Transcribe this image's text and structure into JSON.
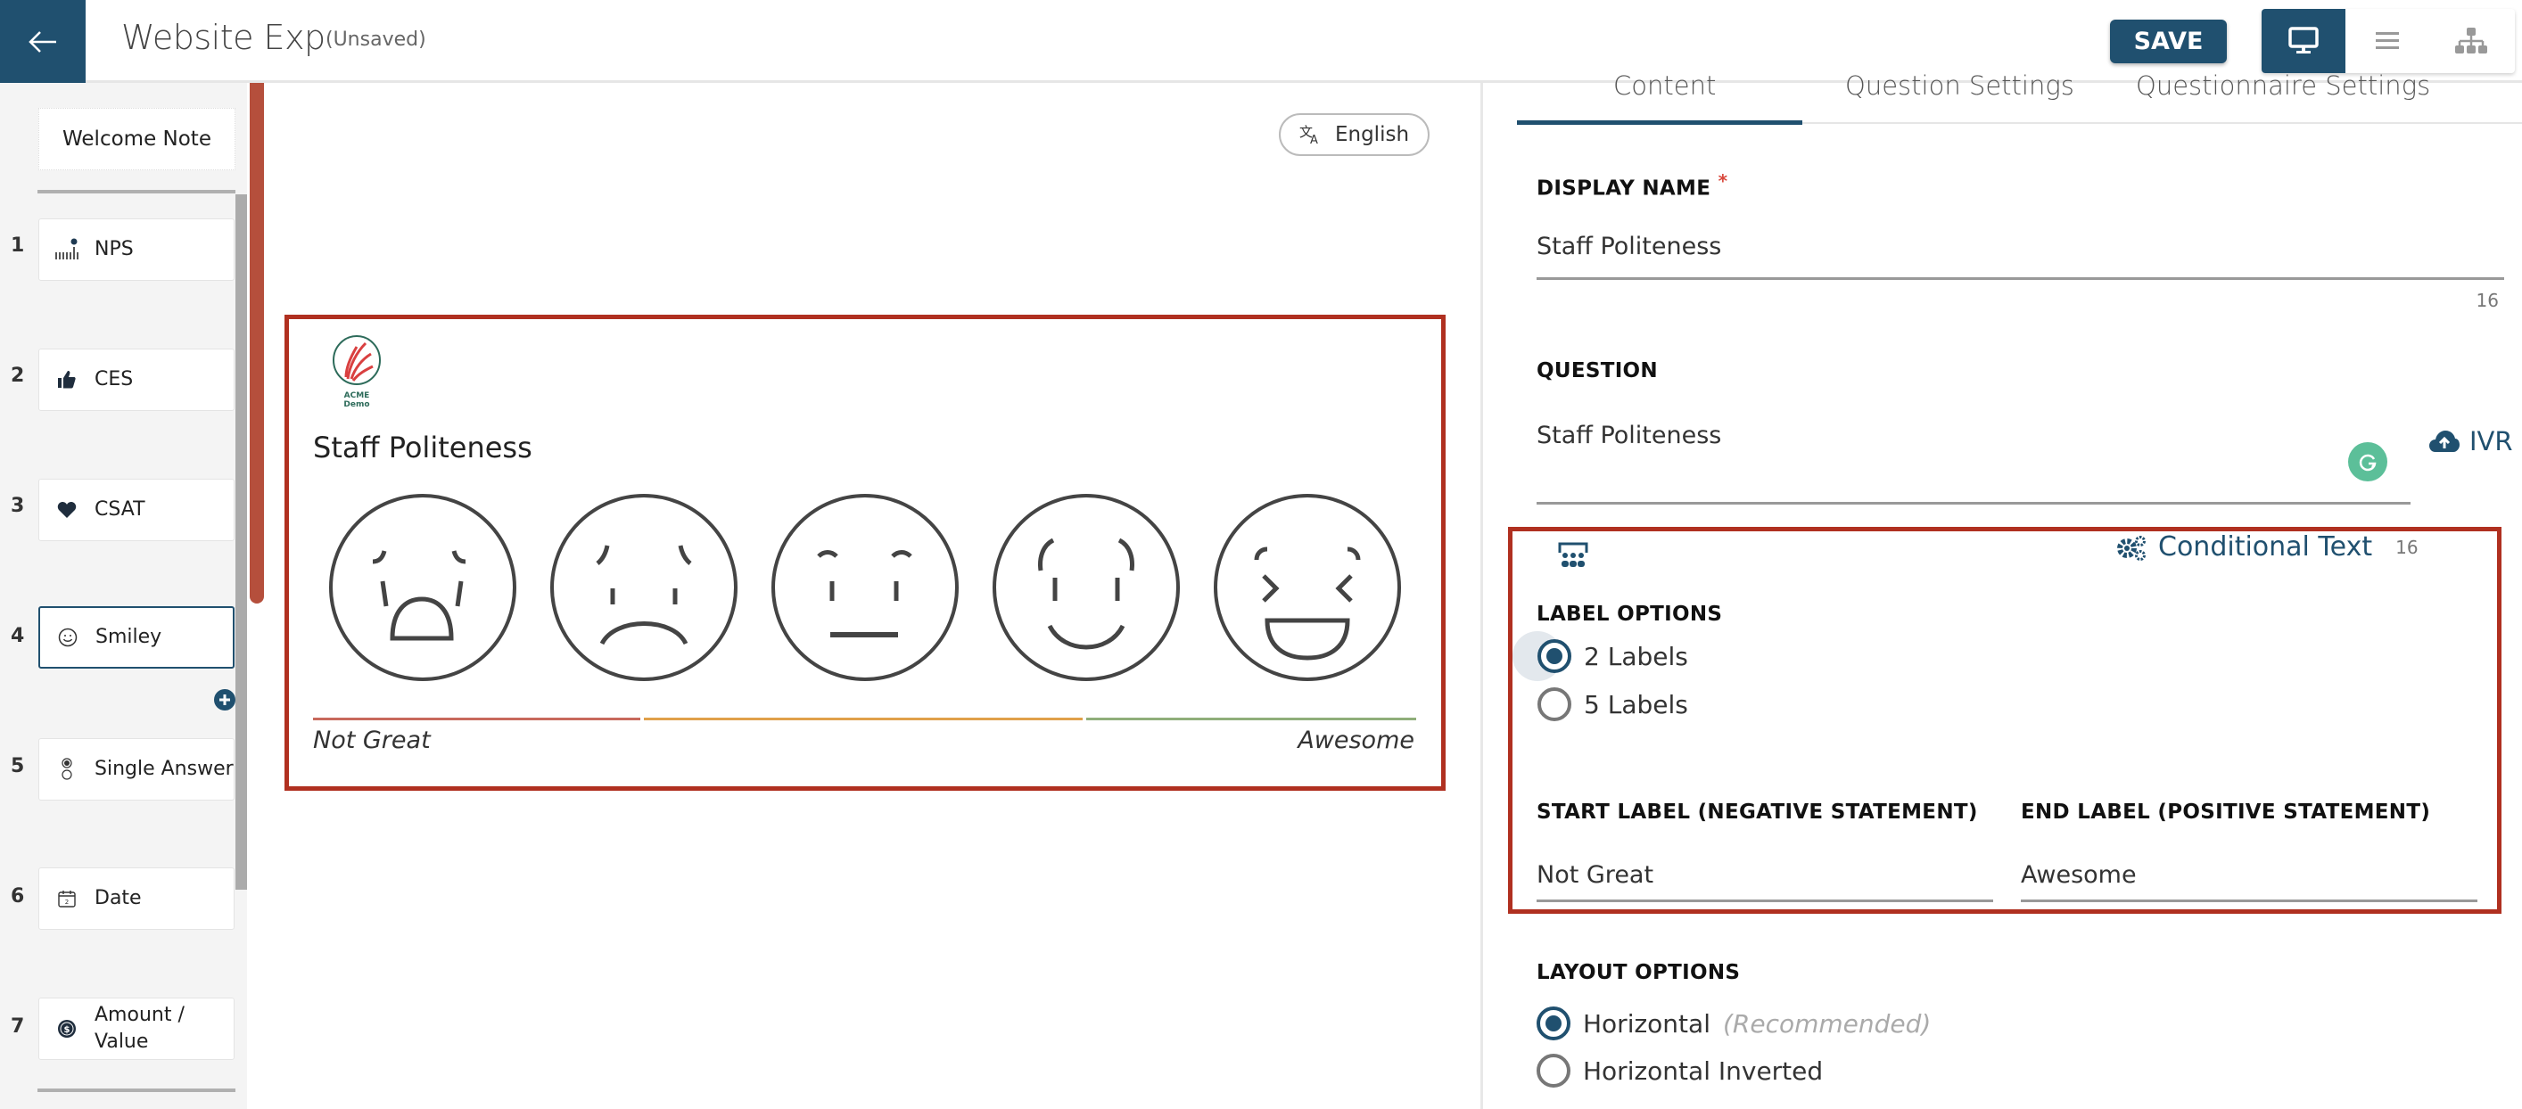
{
  "header": {
    "title": "Website Exp",
    "status": "(Unsaved)",
    "save_label": "SAVE",
    "view_modes": [
      "desktop-preview",
      "list-view",
      "flow-view"
    ],
    "active_view": "desktop-preview"
  },
  "sidebar": {
    "welcome_label": "Welcome Note",
    "questions": [
      {
        "num": "1",
        "label": "NPS",
        "icon": "nps-scale-icon"
      },
      {
        "num": "2",
        "label": "CES",
        "icon": "thumbs-up-icon"
      },
      {
        "num": "3",
        "label": "CSAT",
        "icon": "heart-icon"
      },
      {
        "num": "4",
        "label": "Smiley",
        "icon": "smiley-icon",
        "active": true
      },
      {
        "num": "5",
        "label": "Single Answer",
        "icon": "radio-choice-icon"
      },
      {
        "num": "6",
        "label": "Date",
        "icon": "calendar-icon"
      },
      {
        "num": "7",
        "label": "Amount / Value",
        "icon": "dollar-icon"
      }
    ]
  },
  "preview": {
    "language": "English",
    "logo_text": "ACME Demo",
    "question": "Staff Politeness",
    "faces": [
      "very-unhappy",
      "unhappy",
      "neutral",
      "happy",
      "very-happy"
    ],
    "start_label": "Not Great",
    "end_label": "Awesome",
    "scale_colors": [
      "#c8695c",
      "#e0a04a",
      "#8fae7a"
    ]
  },
  "panel": {
    "tabs": [
      "Content",
      "Question Settings",
      "Questionnaire Settings"
    ],
    "active_tab": "Content",
    "display_name_label": "DISPLAY NAME",
    "display_name_value": "Staff Politeness",
    "display_name_count": "16",
    "question_label": "QUESTION",
    "question_value": "Staff Politeness",
    "ivr_label": "IVR",
    "conditional_text_label": "Conditional Text",
    "conditional_count": "16",
    "label_options_title": "LABEL OPTIONS",
    "label_options": [
      "2 Labels",
      "5 Labels"
    ],
    "label_selected": "2 Labels",
    "start_label_title": "START LABEL (NEGATIVE STATEMENT)",
    "start_label_value": "Not Great",
    "end_label_title": "END LABEL (POSITIVE STATEMENT)",
    "end_label_value": "Awesome",
    "layout_options_title": "LAYOUT OPTIONS",
    "layout_options": [
      "Horizontal",
      "Horizontal Inverted"
    ],
    "layout_recommended_note": "(Recommended)",
    "layout_selected": "Horizontal"
  },
  "colors": {
    "primary": "#20506f",
    "highlight_border": "#b03020",
    "scroll_accent": "#b54f3c",
    "grammarly": "#5cbf99"
  }
}
